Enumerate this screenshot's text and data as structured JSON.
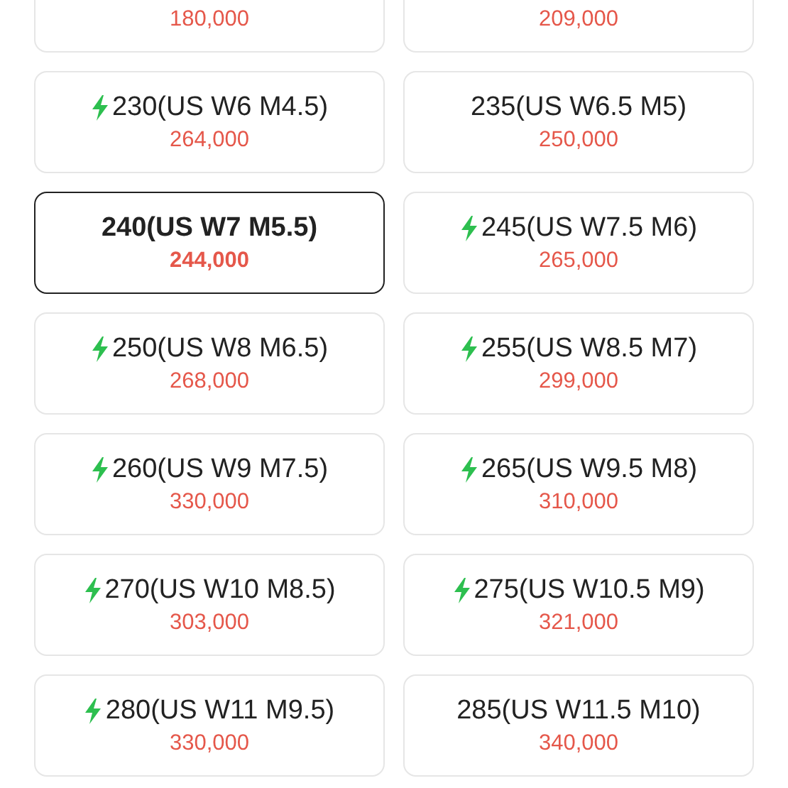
{
  "cut_off_sizes": [
    {
      "price": "180,000"
    },
    {
      "price": "209,000"
    }
  ],
  "sizes": [
    {
      "label": "230(US W6 M4.5)",
      "price": "264,000",
      "express": true,
      "selected": false
    },
    {
      "label": "235(US W6.5 M5)",
      "price": "250,000",
      "express": false,
      "selected": false
    },
    {
      "label": "240(US W7 M5.5)",
      "price": "244,000",
      "express": false,
      "selected": true
    },
    {
      "label": "245(US W7.5 M6)",
      "price": "265,000",
      "express": true,
      "selected": false
    },
    {
      "label": "250(US W8 M6.5)",
      "price": "268,000",
      "express": true,
      "selected": false
    },
    {
      "label": "255(US W8.5 M7)",
      "price": "299,000",
      "express": true,
      "selected": false
    },
    {
      "label": "260(US W9 M7.5)",
      "price": "330,000",
      "express": true,
      "selected": false
    },
    {
      "label": "265(US W9.5 M8)",
      "price": "310,000",
      "express": true,
      "selected": false
    },
    {
      "label": "270(US W10 M8.5)",
      "price": "303,000",
      "express": true,
      "selected": false
    },
    {
      "label": "275(US W10.5 M9)",
      "price": "321,000",
      "express": true,
      "selected": false
    },
    {
      "label": "280(US W11 M9.5)",
      "price": "330,000",
      "express": true,
      "selected": false
    },
    {
      "label": "285(US W11.5 M10)",
      "price": "340,000",
      "express": false,
      "selected": false
    }
  ]
}
